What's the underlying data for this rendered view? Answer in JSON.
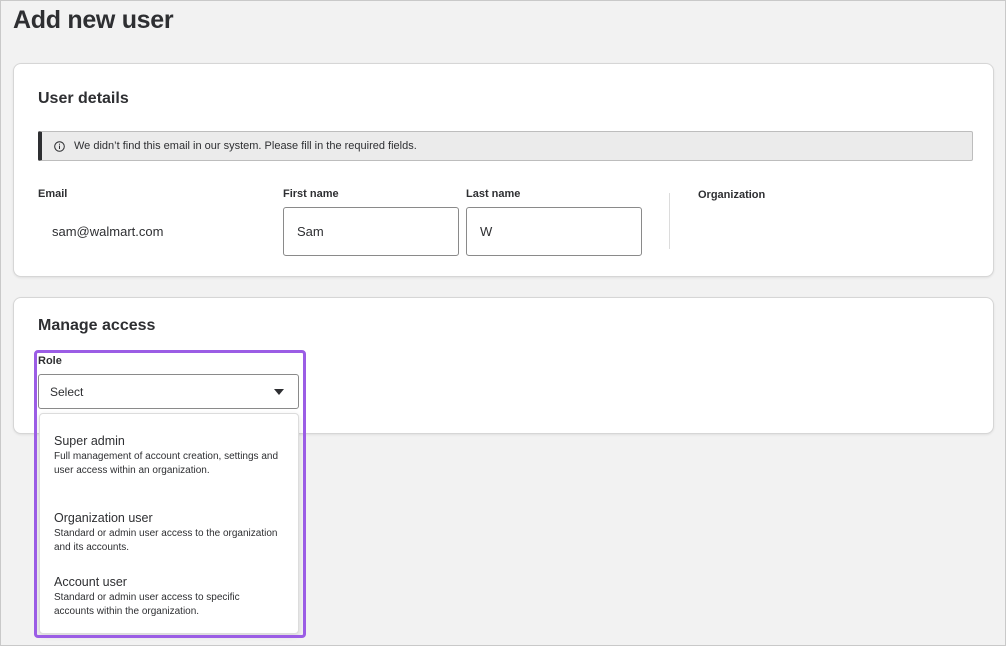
{
  "page": {
    "title": "Add new user"
  },
  "user_details": {
    "title": "User details",
    "alert": {
      "icon": "info-icon",
      "message": "We didn’t find this email in our system. Please fill in the required fields."
    },
    "email": {
      "label": "Email",
      "value": "sam@walmart.com"
    },
    "first_name": {
      "label": "First name",
      "value": "Sam"
    },
    "last_name": {
      "label": "Last name",
      "value": "W"
    },
    "organization": {
      "label": "Organization"
    }
  },
  "manage_access": {
    "title": "Manage access",
    "role": {
      "label": "Role",
      "selected": "Select",
      "icon": "chevron-down-icon",
      "options": [
        {
          "title": "Super admin",
          "description": "Full management of account creation, settings and user access within an organization."
        },
        {
          "title": "Organization user",
          "description": "Standard or admin user access to the organization and its accounts."
        },
        {
          "title": "Account user",
          "description": "Standard or admin user access to specific accounts within the organization."
        }
      ]
    }
  },
  "colors": {
    "highlight": "#9b5de5",
    "text": "#2e2f32",
    "background": "#f2f2f2"
  }
}
